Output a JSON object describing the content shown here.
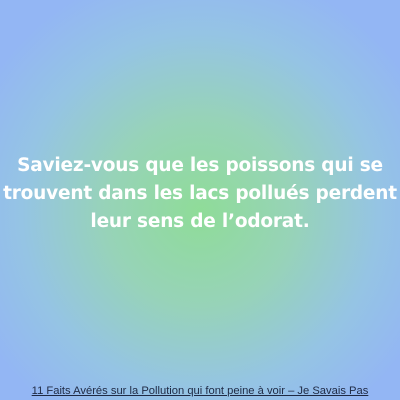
{
  "fact": {
    "lines": [
      "Saviez-vous que les poissons qui se",
      "trouvent dans les lacs pollués perdent",
      "leur sens de l’odorat."
    ]
  },
  "source_link": {
    "text": "11 Faits Avérés sur la Pollution qui font peine à voir – Je Savais Pas"
  },
  "colors": {
    "center": "#8fdc98",
    "edge": "#93b6f4",
    "text": "#ffffff",
    "link": "#1f2a44"
  }
}
